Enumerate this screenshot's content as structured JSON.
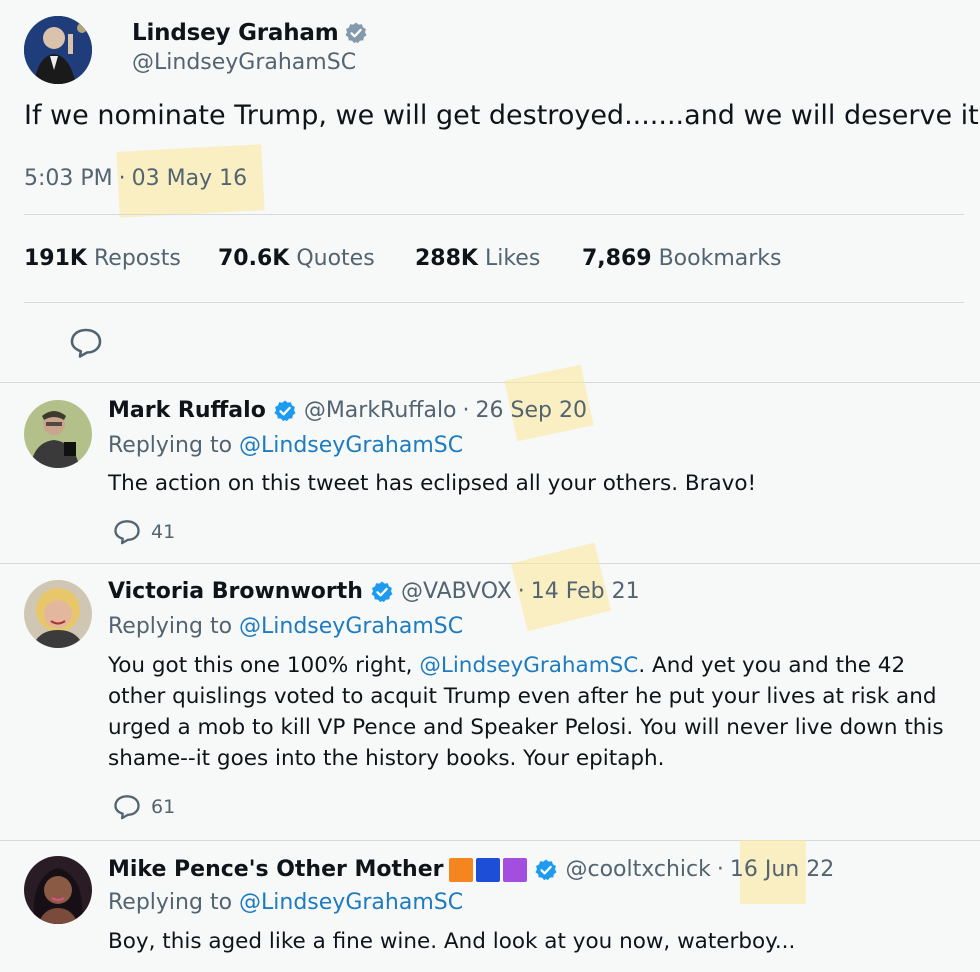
{
  "main_tweet": {
    "author_name": "Lindsey Graham",
    "author_handle": "@LindseyGrahamSC",
    "text": "If we nominate Trump, we will get destroyed.......and we will deserve it.",
    "time": "5:03 PM",
    "separator": "·",
    "date": "03 May 16",
    "stats": [
      {
        "value": "191K",
        "label": "Reposts"
      },
      {
        "value": "70.6K",
        "label": "Quotes"
      },
      {
        "value": "288K",
        "label": "Likes"
      },
      {
        "value": "7,869",
        "label": "Bookmarks"
      }
    ]
  },
  "replies": [
    {
      "name": "Mark Ruffalo",
      "handle": "@MarkRuffalo",
      "date": "26 Sep 20",
      "replying_prefix": "Replying to",
      "replying_to": "@LindseyGrahamSC",
      "text": "The action on this tweet has eclipsed all your others. Bravo!",
      "reply_count": "41"
    },
    {
      "name": "Victoria Brownworth",
      "handle": "@VABVOX",
      "date": "14 Feb 21",
      "replying_prefix": "Replying to",
      "replying_to": "@LindseyGrahamSC",
      "text_mention": "@LindseyGrahamSC",
      "text_before": "You got this one 100% right, ",
      "text_after": ". And yet you and the 42 other quislings voted to acquit Trump even after he put your lives at risk and urged a mob to kill VP Pence and Speaker Pelosi. You will never live down this shame--it goes into the history books. Your epitaph.",
      "reply_count": "61"
    },
    {
      "name": "Mike Pence's Other Mother",
      "handle": "@cooltxchick",
      "date": "16 Jun 22",
      "replying_prefix": "Replying to",
      "replying_to": "@LindseyGrahamSC",
      "text": "Boy, this aged like a fine wine. And look at you now, waterboy...",
      "name_flag_colors": [
        "#f5861f",
        "#1d4ed8",
        "#a44ee0"
      ]
    }
  ],
  "icons": {
    "verified": "verified-badge-icon",
    "reply": "reply-bubble-icon"
  },
  "colors": {
    "link": "#1d7bbf",
    "verified": "#1d9bf0",
    "highlight": "#fde796"
  }
}
